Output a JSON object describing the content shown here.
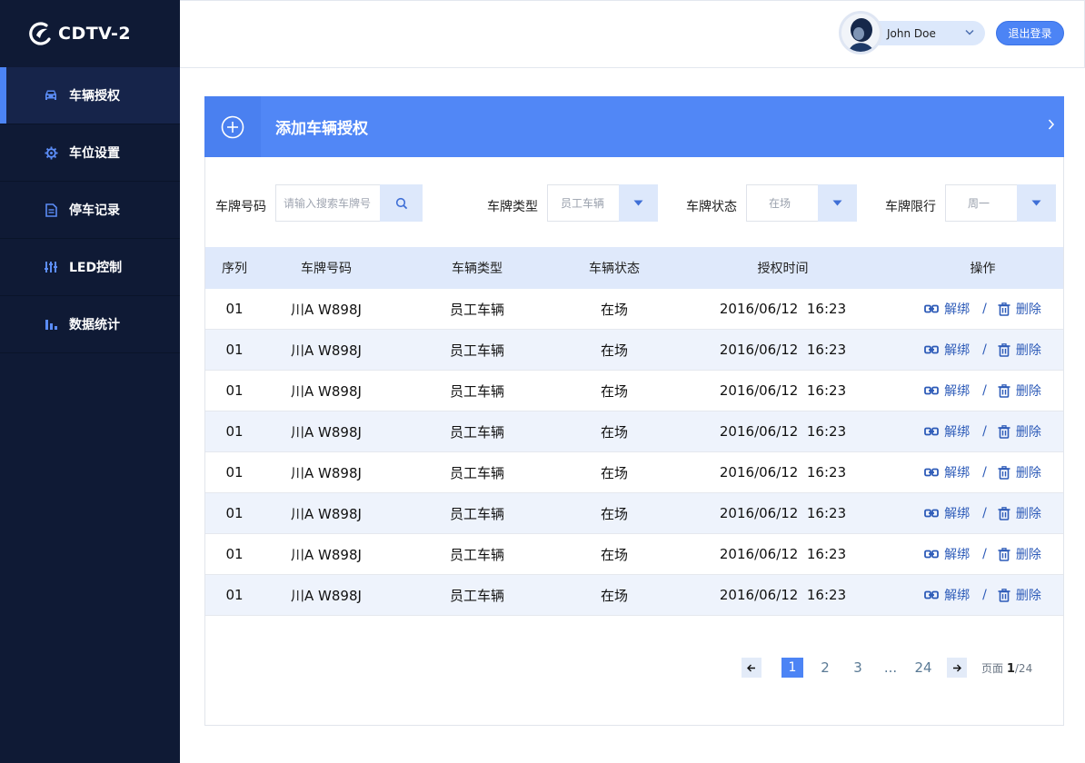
{
  "app": {
    "title": "CDTV-2"
  },
  "sidebar": {
    "items": [
      {
        "label": "车辆授权",
        "icon": "car-icon",
        "active": true
      },
      {
        "label": "车位设置",
        "icon": "gear-icon",
        "active": false
      },
      {
        "label": "停车记录",
        "icon": "document-icon",
        "active": false
      },
      {
        "label": "LED控制",
        "icon": "sliders-icon",
        "active": false
      },
      {
        "label": "数据统计",
        "icon": "bar-chart-icon",
        "active": false
      }
    ]
  },
  "header": {
    "user_name": "John Doe",
    "logout_label": "退出登录"
  },
  "banner": {
    "title": "添加车辆授权"
  },
  "filters": {
    "plate_label": "车牌号码",
    "plate_placeholder": "请输入搜索车牌号",
    "type_label": "车牌类型",
    "type_value": "员工车辆",
    "status_label": "车牌状态",
    "status_value": "在场",
    "limit_label": "车牌限行",
    "limit_value": "周一"
  },
  "table": {
    "headers": [
      "序列",
      "车牌号码",
      "车辆类型",
      "车辆状态",
      "授权时间",
      "操作"
    ],
    "unbind_label": "解绑",
    "delete_label": "删除",
    "separator": "/",
    "rows": [
      [
        "01",
        "川A W898J",
        "员工车辆",
        "在场",
        "2016/06/12  16:23"
      ],
      [
        "01",
        "川A W898J",
        "员工车辆",
        "在场",
        "2016/06/12  16:23"
      ],
      [
        "01",
        "川A W898J",
        "员工车辆",
        "在场",
        "2016/06/12  16:23"
      ],
      [
        "01",
        "川A W898J",
        "员工车辆",
        "在场",
        "2016/06/12  16:23"
      ],
      [
        "01",
        "川A W898J",
        "员工车辆",
        "在场",
        "2016/06/12  16:23"
      ],
      [
        "01",
        "川A W898J",
        "员工车辆",
        "在场",
        "2016/06/12  16:23"
      ],
      [
        "01",
        "川A W898J",
        "员工车辆",
        "在场",
        "2016/06/12  16:23"
      ],
      [
        "01",
        "川A W898J",
        "员工车辆",
        "在场",
        "2016/06/12  16:23"
      ]
    ]
  },
  "pagination": {
    "pages": [
      "1",
      "2",
      "3",
      "...",
      "24"
    ],
    "current": "1",
    "info_prefix": "页面",
    "info_current": "1",
    "info_total": "/24"
  },
  "colors": {
    "sidebar_bg": "#0f1a35",
    "accent": "#4c84f5",
    "link": "#2d5bb8",
    "row_alt": "#eef3fc"
  }
}
